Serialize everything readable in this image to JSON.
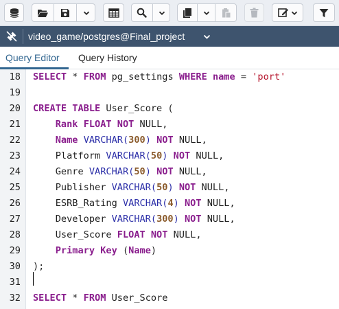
{
  "toolbar": {
    "buttons": [
      {
        "name": "database-icon"
      },
      {
        "name": "open-folder-icon"
      },
      {
        "name": "save-icon"
      },
      {
        "name": "grid-icon"
      },
      {
        "name": "search-icon"
      },
      {
        "name": "copy-icon"
      },
      {
        "name": "paste-icon"
      },
      {
        "name": "trash-icon"
      },
      {
        "name": "edit-icon"
      },
      {
        "name": "filter-icon"
      }
    ]
  },
  "connection": {
    "label": "video_game/postgres@Final_project",
    "icon": "disconnected-plug-icon"
  },
  "tabs": [
    {
      "label": "Query Editor",
      "active": true
    },
    {
      "label": "Query History",
      "active": false
    }
  ],
  "editor": {
    "lines": [
      {
        "num": "18",
        "tokens": [
          {
            "t": "SELECT",
            "c": "kw"
          },
          {
            "t": " * ",
            "c": ""
          },
          {
            "t": "FROM",
            "c": "kw"
          },
          {
            "t": " pg_settings ",
            "c": ""
          },
          {
            "t": "WHERE",
            "c": "kw"
          },
          {
            "t": " ",
            "c": ""
          },
          {
            "t": "name",
            "c": "kw"
          },
          {
            "t": " = ",
            "c": ""
          },
          {
            "t": "'port'",
            "c": "st"
          }
        ]
      },
      {
        "num": "19",
        "tokens": []
      },
      {
        "num": "20",
        "tokens": [
          {
            "t": "CREATE",
            "c": "kw"
          },
          {
            "t": " ",
            "c": ""
          },
          {
            "t": "TABLE",
            "c": "kw"
          },
          {
            "t": " User_Score (",
            "c": ""
          }
        ]
      },
      {
        "num": "21",
        "tokens": [
          {
            "t": "    ",
            "c": ""
          },
          {
            "t": "Rank",
            "c": "kw"
          },
          {
            "t": " ",
            "c": ""
          },
          {
            "t": "FLOAT",
            "c": "kw"
          },
          {
            "t": " ",
            "c": ""
          },
          {
            "t": "NOT",
            "c": "kw"
          },
          {
            "t": " NULL,",
            "c": ""
          }
        ]
      },
      {
        "num": "22",
        "tokens": [
          {
            "t": "    ",
            "c": ""
          },
          {
            "t": "Name",
            "c": "kw"
          },
          {
            "t": " ",
            "c": ""
          },
          {
            "t": "VARCHAR",
            "c": "ty"
          },
          {
            "t": "(",
            "c": "ty"
          },
          {
            "t": "300",
            "c": "nm"
          },
          {
            "t": ")",
            "c": "ty"
          },
          {
            "t": " ",
            "c": ""
          },
          {
            "t": "NOT",
            "c": "kw"
          },
          {
            "t": " NULL,",
            "c": ""
          }
        ]
      },
      {
        "num": "23",
        "tokens": [
          {
            "t": "    Platform ",
            "c": ""
          },
          {
            "t": "VARCHAR",
            "c": "ty"
          },
          {
            "t": "(",
            "c": "ty"
          },
          {
            "t": "50",
            "c": "nm"
          },
          {
            "t": ")",
            "c": "ty"
          },
          {
            "t": " ",
            "c": ""
          },
          {
            "t": "NOT",
            "c": "kw"
          },
          {
            "t": " NULL,",
            "c": ""
          }
        ]
      },
      {
        "num": "24",
        "tokens": [
          {
            "t": "    Genre ",
            "c": ""
          },
          {
            "t": "VARCHAR",
            "c": "ty"
          },
          {
            "t": "(",
            "c": "ty"
          },
          {
            "t": "50",
            "c": "nm"
          },
          {
            "t": ")",
            "c": "ty"
          },
          {
            "t": " ",
            "c": ""
          },
          {
            "t": "NOT",
            "c": "kw"
          },
          {
            "t": " NULL,",
            "c": ""
          }
        ]
      },
      {
        "num": "25",
        "tokens": [
          {
            "t": "    Publisher ",
            "c": ""
          },
          {
            "t": "VARCHAR",
            "c": "ty"
          },
          {
            "t": "(",
            "c": "ty"
          },
          {
            "t": "50",
            "c": "nm"
          },
          {
            "t": ")",
            "c": "ty"
          },
          {
            "t": " ",
            "c": ""
          },
          {
            "t": "NOT",
            "c": "kw"
          },
          {
            "t": " NULL,",
            "c": ""
          }
        ]
      },
      {
        "num": "26",
        "tokens": [
          {
            "t": "    ESRB_Rating ",
            "c": ""
          },
          {
            "t": "VARCHAR",
            "c": "ty"
          },
          {
            "t": "(",
            "c": "ty"
          },
          {
            "t": "4",
            "c": "nm"
          },
          {
            "t": ")",
            "c": "ty"
          },
          {
            "t": " ",
            "c": ""
          },
          {
            "t": "NOT",
            "c": "kw"
          },
          {
            "t": " NULL,",
            "c": ""
          }
        ]
      },
      {
        "num": "27",
        "tokens": [
          {
            "t": "    Developer ",
            "c": ""
          },
          {
            "t": "VARCHAR",
            "c": "ty"
          },
          {
            "t": "(",
            "c": "ty"
          },
          {
            "t": "300",
            "c": "nm"
          },
          {
            "t": ")",
            "c": "ty"
          },
          {
            "t": " ",
            "c": ""
          },
          {
            "t": "NOT",
            "c": "kw"
          },
          {
            "t": " NULL,",
            "c": ""
          }
        ]
      },
      {
        "num": "28",
        "tokens": [
          {
            "t": "    User_Score ",
            "c": ""
          },
          {
            "t": "FLOAT",
            "c": "kw"
          },
          {
            "t": " ",
            "c": ""
          },
          {
            "t": "NOT",
            "c": "kw"
          },
          {
            "t": " NULL,",
            "c": ""
          }
        ]
      },
      {
        "num": "29",
        "tokens": [
          {
            "t": "    ",
            "c": ""
          },
          {
            "t": "Primary",
            "c": "kw"
          },
          {
            "t": " ",
            "c": ""
          },
          {
            "t": "Key",
            "c": "kw"
          },
          {
            "t": " (",
            "c": ""
          },
          {
            "t": "Name",
            "c": "kw"
          },
          {
            "t": ")",
            "c": ""
          }
        ]
      },
      {
        "num": "30",
        "tokens": [
          {
            "t": ");",
            "c": ""
          }
        ]
      },
      {
        "num": "31",
        "tokens": []
      },
      {
        "num": "32",
        "tokens": [
          {
            "t": "SELECT",
            "c": "kw"
          },
          {
            "t": " * ",
            "c": ""
          },
          {
            "t": "FROM",
            "c": "kw"
          },
          {
            "t": " User_Score",
            "c": ""
          }
        ]
      }
    ]
  }
}
